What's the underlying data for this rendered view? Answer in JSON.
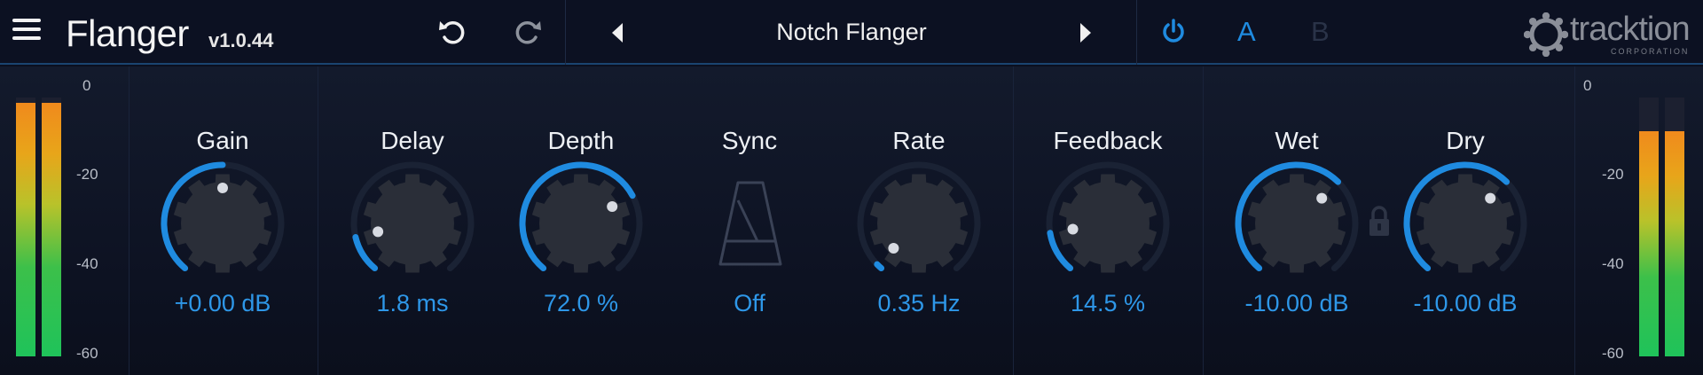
{
  "header": {
    "title": "Flanger",
    "version": "v1.0.44",
    "preset_name": "Notch Flanger",
    "ab_a": "A",
    "ab_b": "B",
    "logo_text": "tracktion",
    "logo_sub": "CORPORATION"
  },
  "meters": {
    "scale": [
      "0",
      "-20",
      "-40",
      "-60"
    ],
    "left_levels": [
      0.98,
      0.98
    ],
    "right_levels": [
      0.87,
      0.87
    ]
  },
  "controls": [
    {
      "label": "Gain",
      "value": "+0.00 dB"
    },
    {
      "label": "Delay",
      "value": "1.8 ms"
    },
    {
      "label": "Depth",
      "value": "72.0 %"
    },
    {
      "label": "Sync",
      "value": "Off"
    },
    {
      "label": "Rate",
      "value": "0.35 Hz"
    },
    {
      "label": "Feedback",
      "value": "14.5 %"
    },
    {
      "label": "Wet",
      "value": "-10.00 dB"
    },
    {
      "label": "Dry",
      "value": "-10.00 dB"
    }
  ],
  "knob_levels": {
    "gain": 0.5,
    "delay": 0.13,
    "depth": 0.72,
    "rate": 0.02,
    "feedback": 0.145,
    "wet": 0.66,
    "dry": 0.66
  },
  "colors": {
    "accent": "#1f8be0",
    "value_text": "#2e97e8",
    "knob_body": "#2a2e38",
    "background": "#0b1020"
  },
  "icons": [
    "menu-icon",
    "undo-icon",
    "redo-icon",
    "preset-prev-icon",
    "preset-next-icon",
    "power-icon",
    "metronome-icon",
    "lock-icon",
    "tracktion-logo-icon"
  ]
}
